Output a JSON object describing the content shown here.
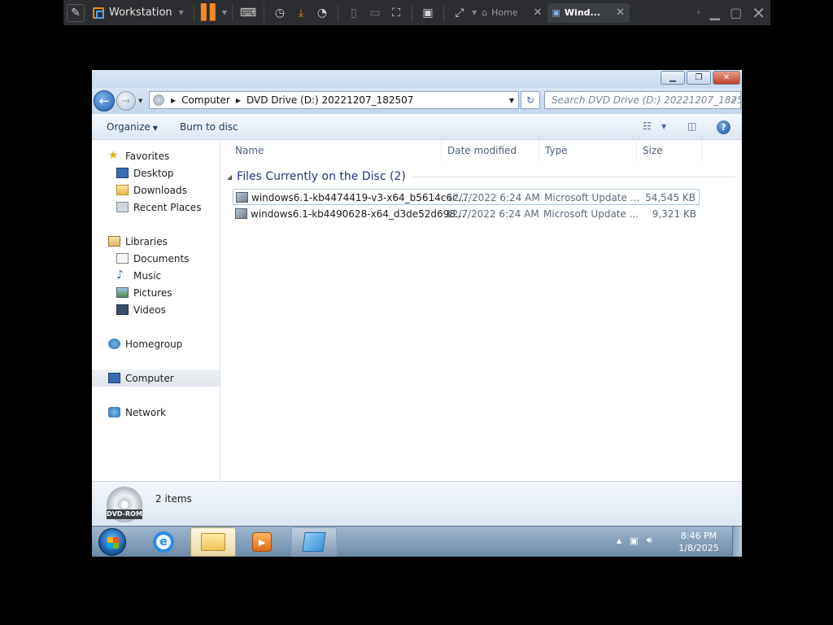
{
  "host": {
    "app_name": "Workstation",
    "tabs": [
      {
        "label": "Home",
        "active": false
      },
      {
        "label": "Wind...",
        "active": true
      }
    ]
  },
  "window": {
    "breadcrumb": [
      "Computer",
      "DVD Drive (D:) 20221207_182507"
    ],
    "search_placeholder": "Search DVD Drive (D:) 20221207_1825...",
    "commands": {
      "organize": "Organize",
      "burn": "Burn to disc"
    }
  },
  "navigation": {
    "favorites": {
      "label": "Favorites",
      "items": [
        "Desktop",
        "Downloads",
        "Recent Places"
      ]
    },
    "libraries": {
      "label": "Libraries",
      "items": [
        "Documents",
        "Music",
        "Pictures",
        "Videos"
      ]
    },
    "homegroup": "Homegroup",
    "computer": "Computer",
    "network": "Network"
  },
  "file_list": {
    "columns": {
      "name": "Name",
      "date": "Date modified",
      "type": "Type",
      "size": "Size"
    },
    "group_label": "Files Currently on the Disc (2)",
    "files": [
      {
        "name": "windows6.1-kb4474419-v3-x64_b5614c6c...",
        "date": "12/7/2022 6:24 AM",
        "type": "Microsoft Update ...",
        "size": "54,545 KB"
      },
      {
        "name": "windows6.1-kb4490628-x64_d3de52d698...",
        "date": "12/7/2022 6:24 AM",
        "type": "Microsoft Update ...",
        "size": "9,321 KB"
      }
    ]
  },
  "details": {
    "item_count": "2 items",
    "drive_label": "DVD-ROM"
  },
  "taskbar": {
    "time": "8:46 PM",
    "date": "1/8/2025"
  },
  "colors": {
    "host_toolbar": "#2b2d30",
    "accent_orange": "#f08a24",
    "nav_text": "#1e395b",
    "group_header": "#1e3a78"
  }
}
